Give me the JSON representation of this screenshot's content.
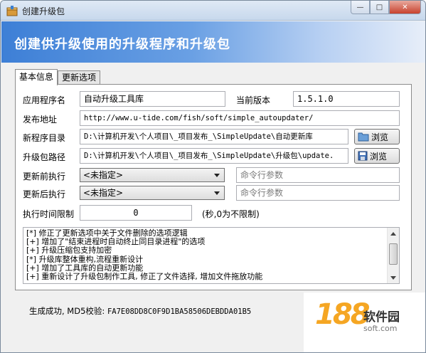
{
  "window": {
    "title": "创建升级包",
    "controls": {
      "minimize": "—",
      "maximize": "□",
      "close": "✕"
    }
  },
  "banner": {
    "title": "创建供升级使用的升级程序和升级包"
  },
  "tabs": [
    {
      "label": "基本信息",
      "active": true
    },
    {
      "label": "更新选项",
      "active": false
    }
  ],
  "form": {
    "app_name_label": "应用程序名",
    "app_name_value": "自动升级工具库",
    "version_label": "当前版本",
    "version_value": "1.5.1.0",
    "publish_label": "发布地址",
    "publish_value": "http://www.u-tide.com/fish/soft/simple_autoupdater/",
    "new_dir_label": "新程序目录",
    "new_dir_value": "D:\\计算机开发\\个人项目\\_项目发布_\\SimpleUpdate\\自动更新库",
    "pkg_path_label": "升级包路径",
    "pkg_path_value": "D:\\计算机开发\\个人项目\\_项目发布_\\SimpleUpdate\\升级包\\update.",
    "browse_label": "浏览",
    "pre_exec_label": "更新前执行",
    "pre_exec_value": "<未指定>",
    "pre_args_placeholder": "命令行参数",
    "post_exec_label": "更新后执行",
    "post_exec_value": "<未指定>",
    "post_args_placeholder": "命令行参数",
    "time_limit_label": "执行时间限制",
    "time_limit_value": "0",
    "time_limit_unit": "(秒,0为不限制)"
  },
  "log": [
    "[*] 修正了更新选项中关于文件删除的选项逻辑",
    "[+] 增加了\"结束进程时自动终止同目录进程\"的选项",
    "[+] 升级压缩包支持加密",
    "[*] 升级库整体重构,流程重新设计",
    "[+] 增加了工具库的自动更新功能",
    "[+] 重新设计了升级包制作工具, 修正了文件选择, 增加文件拖放功能"
  ],
  "status": {
    "label": "生成成功, MD5校验:",
    "hash": "FA7E08DD8C0F9D1BA58506DEBDDA01B5"
  },
  "watermark": {
    "number": "188",
    "name": "软件园",
    "url": "soft.com"
  },
  "colors": {
    "banner_start": "#3d7fd6",
    "banner_end": "#e7eef9",
    "logo_orange": "#f5a623"
  }
}
